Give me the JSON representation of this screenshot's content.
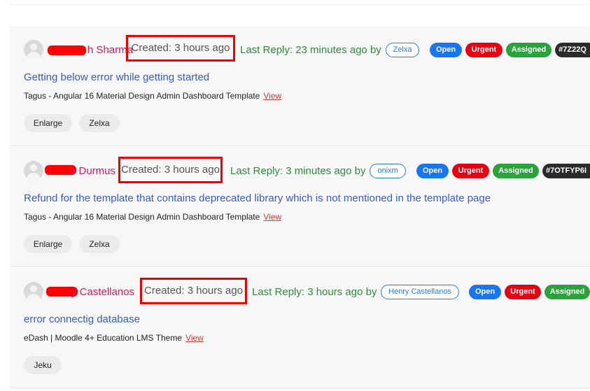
{
  "tickets": [
    {
      "author_visible": "h Sharma",
      "created": "Created: 3 hours ago",
      "last_reply": "Last Reply: 23 minutes ago by",
      "reply_user": "Zelxa",
      "status": "Open",
      "priority": "Urgent",
      "assignment": "Assigned",
      "ticket_id": "#7Z22Q",
      "subject": "Getting below error while getting started",
      "product": "Tagus - Angular 16 Material Design Admin Dashboard Template",
      "view_link": "View",
      "tags": [
        "Enlarge",
        "Zelxa"
      ]
    },
    {
      "author_visible": "e Durmus",
      "created": "Created: 3 hours ago",
      "last_reply": "Last Reply: 3 minutes ago by",
      "reply_user": "onixm",
      "status": "Open",
      "priority": "Urgent",
      "assignment": "Assigned",
      "ticket_id": "#7OTFYP6I",
      "subject": "Refund for the template that contains deprecated library which is not mentioned in the template page",
      "product": "Tagus - Angular 16 Material Design Admin Dashboard Template",
      "view_link": "View",
      "tags": [
        "Enlarge",
        "Zelxa"
      ]
    },
    {
      "author_visible": "y Castellanos",
      "created": "Created: 3 hours ago",
      "last_reply": "Last Reply: 3 hours ago by",
      "reply_user": "Henry Castellanos",
      "status": "Open",
      "priority": "Urgent",
      "assignment": "Assigned",
      "ticket_id": "",
      "subject": "error connectig database",
      "product": "eDash | Moodle 4+ Education LMS Theme",
      "view_link": "View",
      "tags": [
        "Jeku"
      ]
    }
  ],
  "icons": {
    "avatar": "user-avatar-icon"
  },
  "colors": {
    "author": "#d3195b",
    "reply": "#2e8b3e",
    "subject": "#3a5bc7",
    "open": "#1976f2",
    "urgent": "#e60012",
    "assigned": "#2ba33c",
    "highlight": "#ee0000"
  }
}
